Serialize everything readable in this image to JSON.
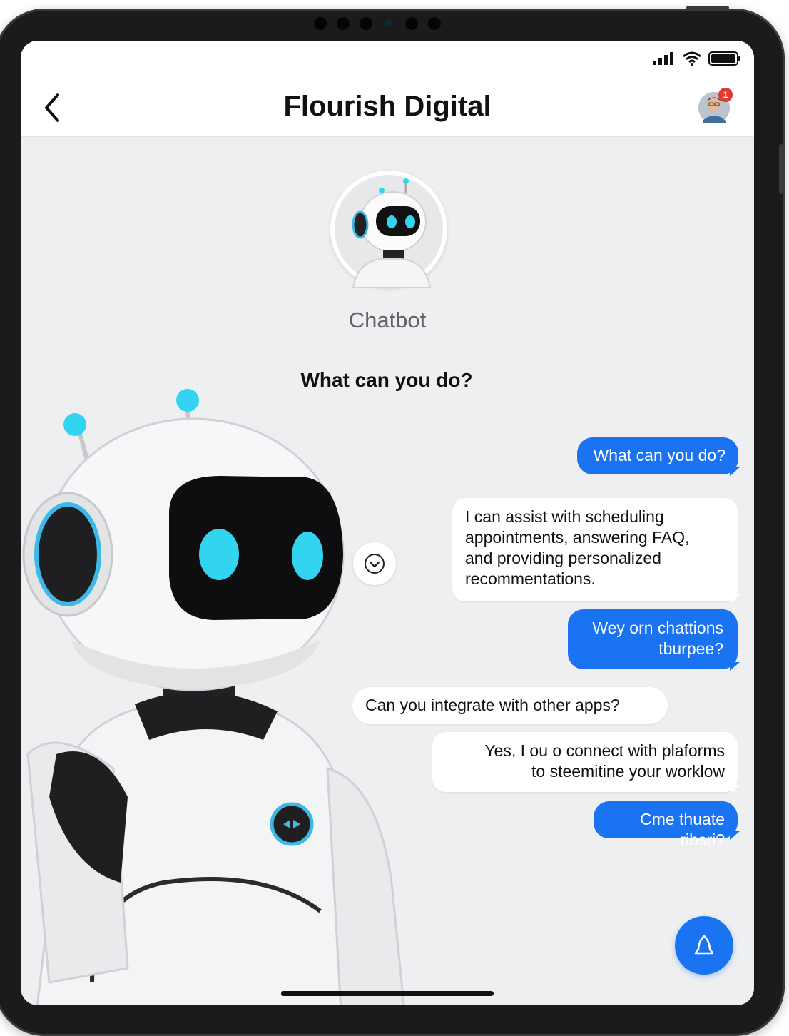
{
  "header": {
    "title": "Flourish Digital",
    "notification_count": "1"
  },
  "bot": {
    "name": "Chatbot",
    "prompt_heading": "What can you do?"
  },
  "messages": [
    {
      "role": "user",
      "text": "What can you do?"
    },
    {
      "role": "bot",
      "lines": [
        "I can assist with scheduling",
        "appointments, answering FAQ,",
        "and providing personalized",
        "recommentations."
      ]
    },
    {
      "role": "user",
      "lines": [
        "Wey orn chattions",
        "tburpee?"
      ]
    },
    {
      "role": "bot",
      "text": "Can you integrate with other apps?"
    },
    {
      "role": "bot",
      "lines": [
        "Yes, I ou o connect with plaforms",
        "to steemitine your worklow"
      ]
    },
    {
      "role": "user",
      "text": "Cme thuate ribsri?"
    }
  ],
  "colors": {
    "accent": "#1a73f0",
    "background": "#eeeff1",
    "robot_glow": "#33d4f0"
  },
  "icons": {
    "back": "chevron-left-icon",
    "signal": "signal-icon",
    "wifi": "wifi-icon",
    "battery": "battery-icon",
    "scroll": "chevron-down-circle-icon",
    "fab": "bell-icon"
  }
}
